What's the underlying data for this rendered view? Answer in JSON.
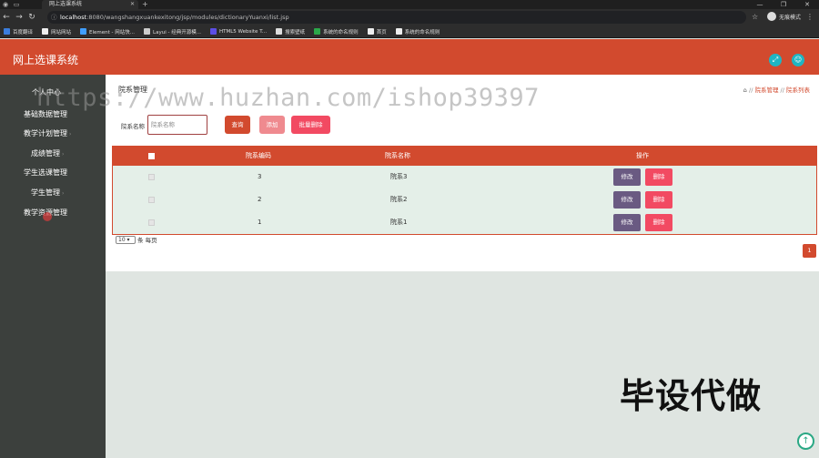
{
  "browser": {
    "tab_title": "网上选课系统",
    "url_host": "localhost",
    "url_rest": ":8080/wangshangxuankexitong/jsp/modules/dictionaryYuanxi/list.jsp",
    "profile_label": "无痕模式",
    "bookmarks": [
      "百度翻译",
      "网站网站",
      "Element - 网站快...",
      "Layui - 经典开源模...",
      "HTML5 Website T...",
      "搜索壁纸",
      "系统的命名规则",
      "首页",
      "系统的命名规则"
    ]
  },
  "app": {
    "title": "网上选课系统"
  },
  "sidebar": {
    "items": [
      "个人中心",
      "基础数据管理",
      "教学计划管理",
      "成绩管理",
      "学生选课管理",
      "学生管理",
      "教学资源管理"
    ]
  },
  "page": {
    "title": "院系管理",
    "breadcrumb": [
      "院系管理",
      "院系列表"
    ],
    "search_label": "院系名称",
    "search_placeholder": "院系名称",
    "buttons": {
      "query": "查询",
      "add": "添加",
      "batch_delete": "批量删除"
    },
    "table": {
      "headers": [
        "院系编码",
        "院系名称",
        "操作"
      ],
      "rows": [
        {
          "code": "3",
          "name": "院系3"
        },
        {
          "code": "2",
          "name": "院系2"
        },
        {
          "code": "1",
          "name": "院系1"
        }
      ],
      "edit_label": "修改",
      "delete_label": "删除"
    },
    "page_size": "10",
    "page_size_suffix": "条 每页",
    "current_page": "1"
  },
  "overlay": {
    "watermark": "https://www.huzhan.com/ishop39397",
    "stamp": "毕设代做"
  },
  "colors": {
    "primary": "#d24a2e",
    "sidebar": "#3c403d",
    "accent": "#1fb5c2",
    "edit": "#6a5a82",
    "delete": "#f24a62"
  }
}
